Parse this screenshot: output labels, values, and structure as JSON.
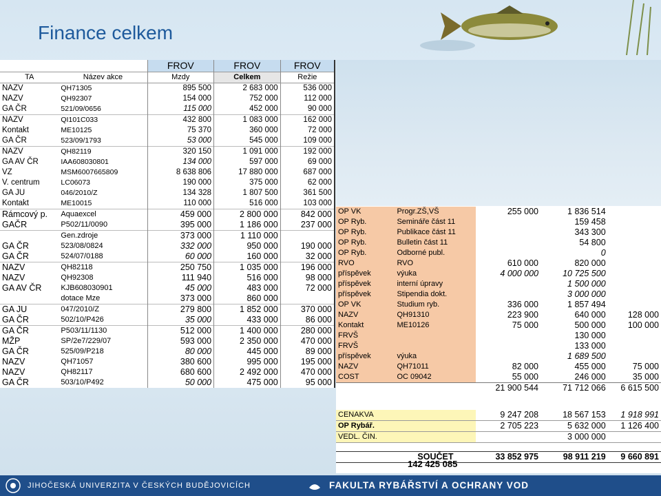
{
  "title": "Finance celkem",
  "left": {
    "header_top": [
      "FROV",
      "FROV",
      "FROV"
    ],
    "header": [
      "TA",
      "Název akce",
      "Mzdy",
      "Celkem",
      "Režie"
    ],
    "rows": [
      [
        "NAZV",
        "QH71305",
        "895 500",
        "2 683 000",
        "536 000"
      ],
      [
        "NAZV",
        "QH92307",
        "154 000",
        "752 000",
        "112 000"
      ],
      [
        "GA ČR",
        "521/09/0656",
        "115 000",
        "452 000",
        "90 000"
      ],
      [
        "NAZV",
        "QI101C033",
        "432 800",
        "1 083 000",
        "162 000"
      ],
      [
        "Kontakt",
        "ME10125",
        "75 370",
        "360 000",
        "72 000"
      ],
      [
        "GA ČR",
        "523/09/1793",
        "53 000",
        "545 000",
        "109 000"
      ],
      [
        "NAZV",
        "QH82119",
        "320 150",
        "1 091 000",
        "192 000"
      ],
      [
        "GA AV ČR",
        "IAA608030801",
        "134 000",
        "597 000",
        "69 000"
      ],
      [
        "VZ",
        "MSM6007665809",
        "8 638 806",
        "17 880 000",
        "687 000"
      ],
      [
        "V. centrum",
        "LC06073",
        "190 000",
        "375 000",
        "62 000"
      ],
      [
        "GA JU",
        "046/2010/Z",
        "134 328",
        "1 807 500",
        "361 500"
      ],
      [
        "Kontakt",
        "ME10015",
        "110 000",
        "516 000",
        "103 000"
      ],
      [
        "Rámcový p.",
        "Aquaexcel",
        "459 000",
        "2 800 000",
        "842 000"
      ],
      [
        "GAČR",
        "P502/11/0090",
        "395 000",
        "1 186 000",
        "237 000"
      ],
      [
        "",
        "Gen.zdroje",
        "373 000",
        "1 110 000",
        ""
      ],
      [
        "GA ČR",
        "523/08/0824",
        "332 000",
        "950 000",
        "190 000"
      ],
      [
        "GA ČR",
        "524/07/0188",
        "60 000",
        "160 000",
        "32 000"
      ],
      [
        "NAZV",
        "QH82118",
        "250 750",
        "1 035 000",
        "196 000"
      ],
      [
        "NAZV",
        "QH92308",
        "111 940",
        "516 000",
        "98 000"
      ],
      [
        "GA AV ČR",
        "KJB608030901",
        "45 000",
        "483 000",
        "72 000"
      ],
      [
        "",
        "dotace Mze",
        "373 000",
        "860 000",
        ""
      ],
      [
        "GA JU",
        "047/2010/Z",
        "279 800",
        "1 852 000",
        "370 000"
      ],
      [
        "GA ČR",
        "502/10/P426",
        "35 000",
        "433 000",
        "86 000"
      ],
      [
        "GA ČR",
        "P503/11/1130",
        "512 000",
        "1 400 000",
        "280 000"
      ],
      [
        "MŽP",
        "SP/2e7/229/07",
        "593 000",
        "2 350 000",
        "470 000"
      ],
      [
        "GA ČR",
        "525/09/P218",
        "80 000",
        "445 000",
        "89 000"
      ],
      [
        "NAZV",
        "QH71057",
        "380 600",
        "995 000",
        "195 000"
      ],
      [
        "NAZV",
        "QH82117",
        "680 600",
        "2 492 000",
        "470 000"
      ],
      [
        "GA ČR",
        "503/10/P492",
        "50 000",
        "475 000",
        "95 000"
      ]
    ]
  },
  "right": {
    "partial_row": [
      "GA ČR",
      "503/10/P492",
      "50 000",
      "475 000",
      "95 000"
    ],
    "rows": [
      [
        "OP VK",
        "Progr.ZŠ,VŠ",
        "255 000",
        "1 836 514",
        ""
      ],
      [
        "OP Ryb.",
        "Semináře část 11",
        "",
        "159 458",
        ""
      ],
      [
        "OP Ryb.",
        "Publikace část 11",
        "",
        "343 300",
        ""
      ],
      [
        "OP Ryb.",
        "Bulletin část 11",
        "",
        "54 800",
        ""
      ],
      [
        "OP Ryb.",
        "Odborné publ.",
        "",
        "0",
        ""
      ],
      [
        "RVO",
        "RVO",
        "610 000",
        "820 000",
        ""
      ],
      [
        "příspěvek",
        "výuka",
        "4 000 000",
        "10 725 500",
        ""
      ],
      [
        "příspěvek",
        "interní úpravy",
        "",
        "1 500 000",
        ""
      ],
      [
        "příspěvek",
        "Stipendia dokt.",
        "",
        "3 000 000",
        ""
      ],
      [
        "OP VK",
        "Studium ryb.",
        "336 000",
        "1 857 494",
        ""
      ],
      [
        "NAZV",
        "QH91310",
        "223 900",
        "640 000",
        "128 000"
      ],
      [
        "Kontakt",
        "ME10126",
        "75 000",
        "500 000",
        "100 000"
      ],
      [
        "FRVŠ",
        "",
        "",
        "130 000",
        ""
      ],
      [
        "FRVŠ",
        "",
        "",
        "133 000",
        ""
      ],
      [
        "příspěvek",
        "výuka",
        "",
        "1 689 500",
        ""
      ],
      [
        "NAZV",
        "QH71011",
        "82 000",
        "455 000",
        "75 000"
      ],
      [
        "COST",
        "OC 09042",
        "55 000",
        "246 000",
        "35 000"
      ]
    ],
    "subtotal": [
      "21 900 544",
      "71 712 066",
      "6 615 500"
    ],
    "extra": [
      [
        "CENAKVA",
        "9 247 208",
        "18 567 153",
        "1 918 991"
      ],
      [
        "OP Rybář.",
        "2 705 223",
        "5 632 000",
        "1 126 400"
      ],
      [
        "VEDL. ČIN.",
        "",
        "3 000 000",
        ""
      ]
    ],
    "soucet_label": "SOUČET",
    "soucet": [
      "33 852 975",
      "98 911 219",
      "9 660 891"
    ],
    "grand_total": "142 425 085"
  },
  "footer": {
    "university": "JIHOČESKÁ UNIVERZITA V ČESKÝCH BUDĚJOVICÍCH",
    "faculty": "FAKULTA RYBÁŘSTVÍ A OCHRANY VOD"
  },
  "colors": {
    "title": "#1e5a9c",
    "footer": "#1f4e8a",
    "orange": "#f6c9a6",
    "yellow": "#fdf6b8"
  }
}
